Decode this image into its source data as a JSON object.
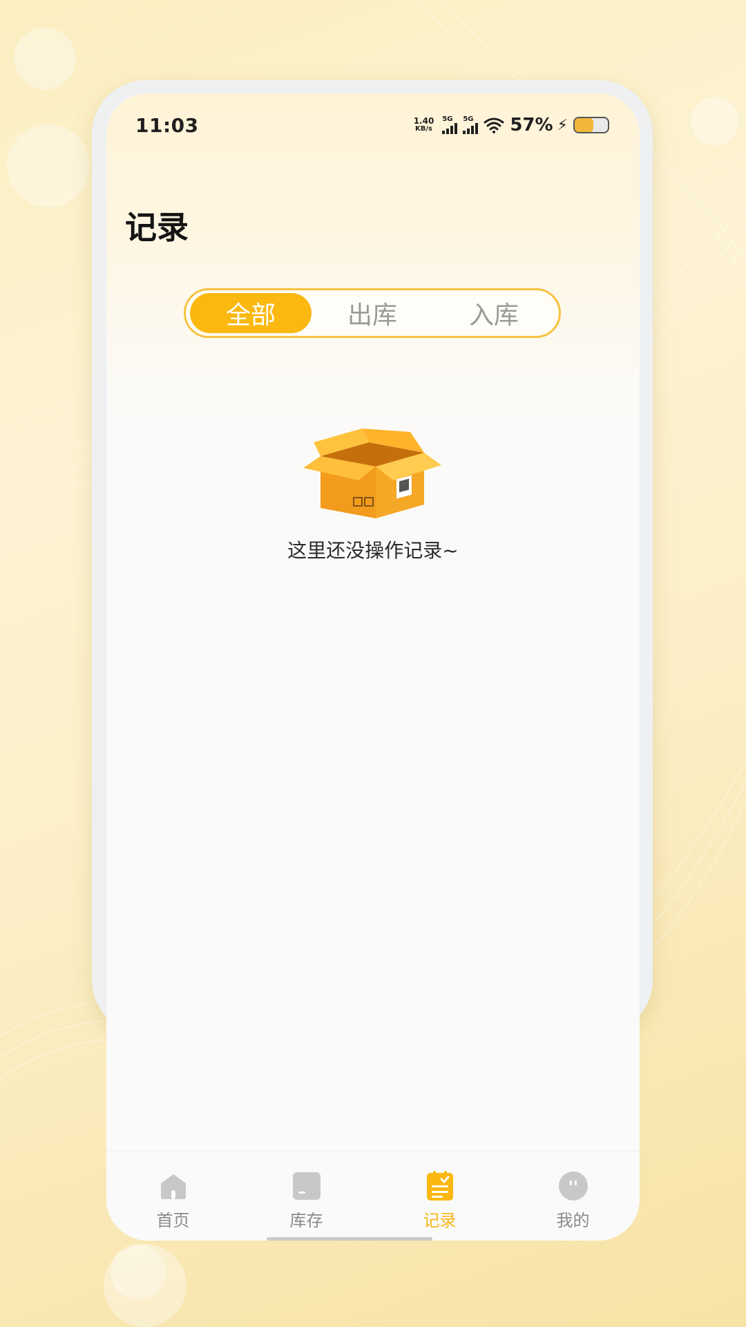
{
  "status_bar": {
    "time": "11:03",
    "net_speed_value": "1.40",
    "net_speed_unit": "KB/s",
    "signal1_label": "5G",
    "signal2_label": "5G",
    "battery_percent": "57%",
    "battery_level": 0.57,
    "charging": true
  },
  "page": {
    "title": "记录"
  },
  "tabs": [
    {
      "label": "全部",
      "active": true
    },
    {
      "label": "出库",
      "active": false
    },
    {
      "label": "入库",
      "active": false
    }
  ],
  "empty_state": {
    "message": "这里还没操作记录~",
    "icon": "open-box-icon"
  },
  "bottom_nav": [
    {
      "label": "首页",
      "icon": "home-icon",
      "active": false
    },
    {
      "label": "库存",
      "icon": "inventory-icon",
      "active": false
    },
    {
      "label": "记录",
      "icon": "records-icon",
      "active": true
    },
    {
      "label": "我的",
      "icon": "profile-icon",
      "active": false
    }
  ],
  "colors": {
    "accent": "#fbb811",
    "inactive_text": "#9a9a9a",
    "nav_inactive_icon": "#c8c8c8"
  }
}
